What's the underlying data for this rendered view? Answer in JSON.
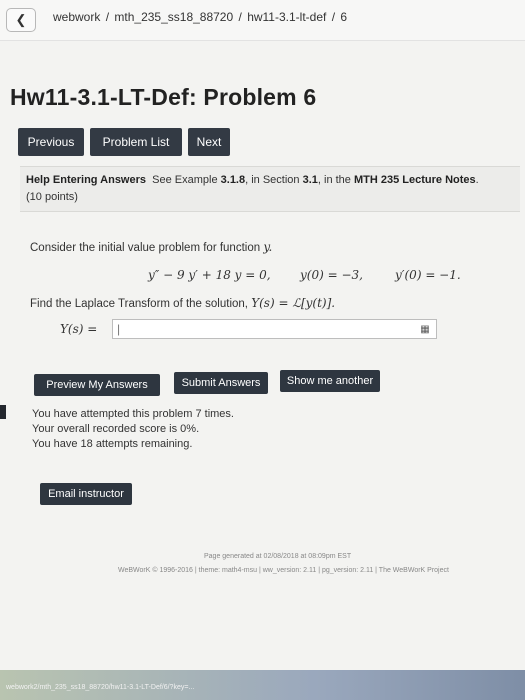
{
  "breadcrumb": {
    "items": [
      "webwork",
      "mth_235_ss18_88720",
      "hw11-3.1-lt-def",
      "6"
    ],
    "separator": "/"
  },
  "page": {
    "title": "Hw11-3.1-LT-Def: Problem 6"
  },
  "nav": {
    "previous": "Previous",
    "problem_list": "Problem List",
    "next": "Next"
  },
  "help": {
    "heading": "Help Entering Answers",
    "text_a": "See Example",
    "example": "3.1.8",
    "text_b": ", in Section",
    "section": "3.1",
    "text_c": ", in the",
    "notes": "MTH 235 Lecture Notes",
    "text_d": ".",
    "points": "(10 points)"
  },
  "problem": {
    "intro": "Consider the initial value problem for function",
    "fn_var": "y.",
    "equation": "y″ − 9 y′ + 18 y = 0,",
    "ic1": "y(0) = −3,",
    "ic2": "y′(0) = −1.",
    "question": "Find the Laplace Transform of the solution,",
    "question_math": "Y(s) = ℒ[y(t)].",
    "answer_label": "Y(s) =",
    "answer_value": "|"
  },
  "actions": {
    "preview": "Preview My Answers",
    "submit": "Submit Answers",
    "show_another": "Show me another"
  },
  "status": {
    "attempted": "You have attempted this problem 7 times.",
    "score": "Your overall recorded score is 0%.",
    "remaining": "You have 18 attempts remaining."
  },
  "email": "Email instructor",
  "footer": {
    "generated": "Page generated at 02/08/2018 at 08:09pm EST",
    "copyright": "WeBWorK © 1996-2016 | theme: math4-msu | ww_version: 2.11 | pg_version: 2.11 | The WeBWorK Project"
  },
  "bottom_url": "webwork2/mth_235_ss18_88720/hw11-3.1-LT-Def/6/?key=...",
  "colors": {
    "button_bg": "#333a44",
    "page_bg": "#f3f3f1"
  }
}
